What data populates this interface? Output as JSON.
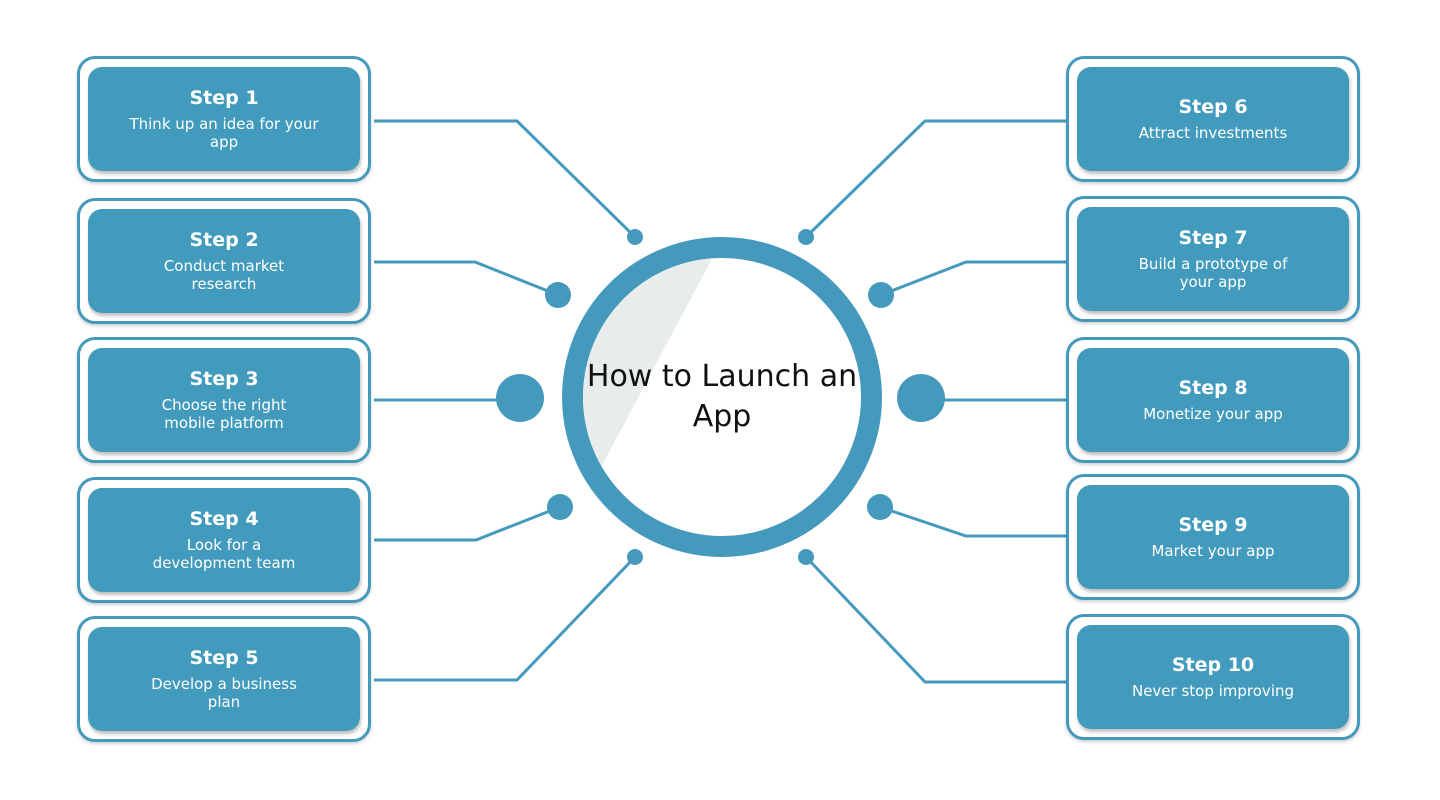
{
  "title": "How to Launch an App",
  "colors": {
    "accent": "#429bbd",
    "ring": "#4499bd",
    "text_dark": "#111111",
    "shade": "#e9ecec"
  },
  "steps_left": [
    {
      "title": "Step 1",
      "desc": "Think up an idea for your app"
    },
    {
      "title": "Step 2",
      "desc": "Conduct market research"
    },
    {
      "title": "Step 3",
      "desc": "Choose the right mobile platform"
    },
    {
      "title": "Step 4",
      "desc": "Look for a development team"
    },
    {
      "title": "Step 5",
      "desc": "Develop a business plan"
    }
  ],
  "steps_right": [
    {
      "title": "Step 6",
      "desc": "Attract investments"
    },
    {
      "title": "Step 7",
      "desc": "Build a prototype of your app"
    },
    {
      "title": "Step 8",
      "desc": "Monetize your app"
    },
    {
      "title": "Step 9",
      "desc": "Market your app"
    },
    {
      "title": "Step 10",
      "desc": "Never stop improving"
    }
  ]
}
